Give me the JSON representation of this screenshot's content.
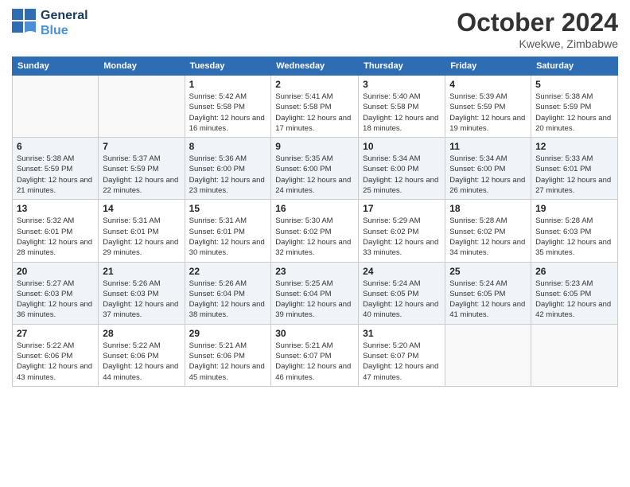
{
  "header": {
    "logo_line1": "General",
    "logo_line2": "Blue",
    "month": "October 2024",
    "location": "Kwekwe, Zimbabwe"
  },
  "weekdays": [
    "Sunday",
    "Monday",
    "Tuesday",
    "Wednesday",
    "Thursday",
    "Friday",
    "Saturday"
  ],
  "weeks": [
    [
      {
        "day": "",
        "sunrise": "",
        "sunset": "",
        "daylight": ""
      },
      {
        "day": "",
        "sunrise": "",
        "sunset": "",
        "daylight": ""
      },
      {
        "day": "1",
        "sunrise": "Sunrise: 5:42 AM",
        "sunset": "Sunset: 5:58 PM",
        "daylight": "Daylight: 12 hours and 16 minutes."
      },
      {
        "day": "2",
        "sunrise": "Sunrise: 5:41 AM",
        "sunset": "Sunset: 5:58 PM",
        "daylight": "Daylight: 12 hours and 17 minutes."
      },
      {
        "day": "3",
        "sunrise": "Sunrise: 5:40 AM",
        "sunset": "Sunset: 5:58 PM",
        "daylight": "Daylight: 12 hours and 18 minutes."
      },
      {
        "day": "4",
        "sunrise": "Sunrise: 5:39 AM",
        "sunset": "Sunset: 5:59 PM",
        "daylight": "Daylight: 12 hours and 19 minutes."
      },
      {
        "day": "5",
        "sunrise": "Sunrise: 5:38 AM",
        "sunset": "Sunset: 5:59 PM",
        "daylight": "Daylight: 12 hours and 20 minutes."
      }
    ],
    [
      {
        "day": "6",
        "sunrise": "Sunrise: 5:38 AM",
        "sunset": "Sunset: 5:59 PM",
        "daylight": "Daylight: 12 hours and 21 minutes."
      },
      {
        "day": "7",
        "sunrise": "Sunrise: 5:37 AM",
        "sunset": "Sunset: 5:59 PM",
        "daylight": "Daylight: 12 hours and 22 minutes."
      },
      {
        "day": "8",
        "sunrise": "Sunrise: 5:36 AM",
        "sunset": "Sunset: 6:00 PM",
        "daylight": "Daylight: 12 hours and 23 minutes."
      },
      {
        "day": "9",
        "sunrise": "Sunrise: 5:35 AM",
        "sunset": "Sunset: 6:00 PM",
        "daylight": "Daylight: 12 hours and 24 minutes."
      },
      {
        "day": "10",
        "sunrise": "Sunrise: 5:34 AM",
        "sunset": "Sunset: 6:00 PM",
        "daylight": "Daylight: 12 hours and 25 minutes."
      },
      {
        "day": "11",
        "sunrise": "Sunrise: 5:34 AM",
        "sunset": "Sunset: 6:00 PM",
        "daylight": "Daylight: 12 hours and 26 minutes."
      },
      {
        "day": "12",
        "sunrise": "Sunrise: 5:33 AM",
        "sunset": "Sunset: 6:01 PM",
        "daylight": "Daylight: 12 hours and 27 minutes."
      }
    ],
    [
      {
        "day": "13",
        "sunrise": "Sunrise: 5:32 AM",
        "sunset": "Sunset: 6:01 PM",
        "daylight": "Daylight: 12 hours and 28 minutes."
      },
      {
        "day": "14",
        "sunrise": "Sunrise: 5:31 AM",
        "sunset": "Sunset: 6:01 PM",
        "daylight": "Daylight: 12 hours and 29 minutes."
      },
      {
        "day": "15",
        "sunrise": "Sunrise: 5:31 AM",
        "sunset": "Sunset: 6:01 PM",
        "daylight": "Daylight: 12 hours and 30 minutes."
      },
      {
        "day": "16",
        "sunrise": "Sunrise: 5:30 AM",
        "sunset": "Sunset: 6:02 PM",
        "daylight": "Daylight: 12 hours and 32 minutes."
      },
      {
        "day": "17",
        "sunrise": "Sunrise: 5:29 AM",
        "sunset": "Sunset: 6:02 PM",
        "daylight": "Daylight: 12 hours and 33 minutes."
      },
      {
        "day": "18",
        "sunrise": "Sunrise: 5:28 AM",
        "sunset": "Sunset: 6:02 PM",
        "daylight": "Daylight: 12 hours and 34 minutes."
      },
      {
        "day": "19",
        "sunrise": "Sunrise: 5:28 AM",
        "sunset": "Sunset: 6:03 PM",
        "daylight": "Daylight: 12 hours and 35 minutes."
      }
    ],
    [
      {
        "day": "20",
        "sunrise": "Sunrise: 5:27 AM",
        "sunset": "Sunset: 6:03 PM",
        "daylight": "Daylight: 12 hours and 36 minutes."
      },
      {
        "day": "21",
        "sunrise": "Sunrise: 5:26 AM",
        "sunset": "Sunset: 6:03 PM",
        "daylight": "Daylight: 12 hours and 37 minutes."
      },
      {
        "day": "22",
        "sunrise": "Sunrise: 5:26 AM",
        "sunset": "Sunset: 6:04 PM",
        "daylight": "Daylight: 12 hours and 38 minutes."
      },
      {
        "day": "23",
        "sunrise": "Sunrise: 5:25 AM",
        "sunset": "Sunset: 6:04 PM",
        "daylight": "Daylight: 12 hours and 39 minutes."
      },
      {
        "day": "24",
        "sunrise": "Sunrise: 5:24 AM",
        "sunset": "Sunset: 6:05 PM",
        "daylight": "Daylight: 12 hours and 40 minutes."
      },
      {
        "day": "25",
        "sunrise": "Sunrise: 5:24 AM",
        "sunset": "Sunset: 6:05 PM",
        "daylight": "Daylight: 12 hours and 41 minutes."
      },
      {
        "day": "26",
        "sunrise": "Sunrise: 5:23 AM",
        "sunset": "Sunset: 6:05 PM",
        "daylight": "Daylight: 12 hours and 42 minutes."
      }
    ],
    [
      {
        "day": "27",
        "sunrise": "Sunrise: 5:22 AM",
        "sunset": "Sunset: 6:06 PM",
        "daylight": "Daylight: 12 hours and 43 minutes."
      },
      {
        "day": "28",
        "sunrise": "Sunrise: 5:22 AM",
        "sunset": "Sunset: 6:06 PM",
        "daylight": "Daylight: 12 hours and 44 minutes."
      },
      {
        "day": "29",
        "sunrise": "Sunrise: 5:21 AM",
        "sunset": "Sunset: 6:06 PM",
        "daylight": "Daylight: 12 hours and 45 minutes."
      },
      {
        "day": "30",
        "sunrise": "Sunrise: 5:21 AM",
        "sunset": "Sunset: 6:07 PM",
        "daylight": "Daylight: 12 hours and 46 minutes."
      },
      {
        "day": "31",
        "sunrise": "Sunrise: 5:20 AM",
        "sunset": "Sunset: 6:07 PM",
        "daylight": "Daylight: 12 hours and 47 minutes."
      },
      {
        "day": "",
        "sunrise": "",
        "sunset": "",
        "daylight": ""
      },
      {
        "day": "",
        "sunrise": "",
        "sunset": "",
        "daylight": ""
      }
    ]
  ]
}
